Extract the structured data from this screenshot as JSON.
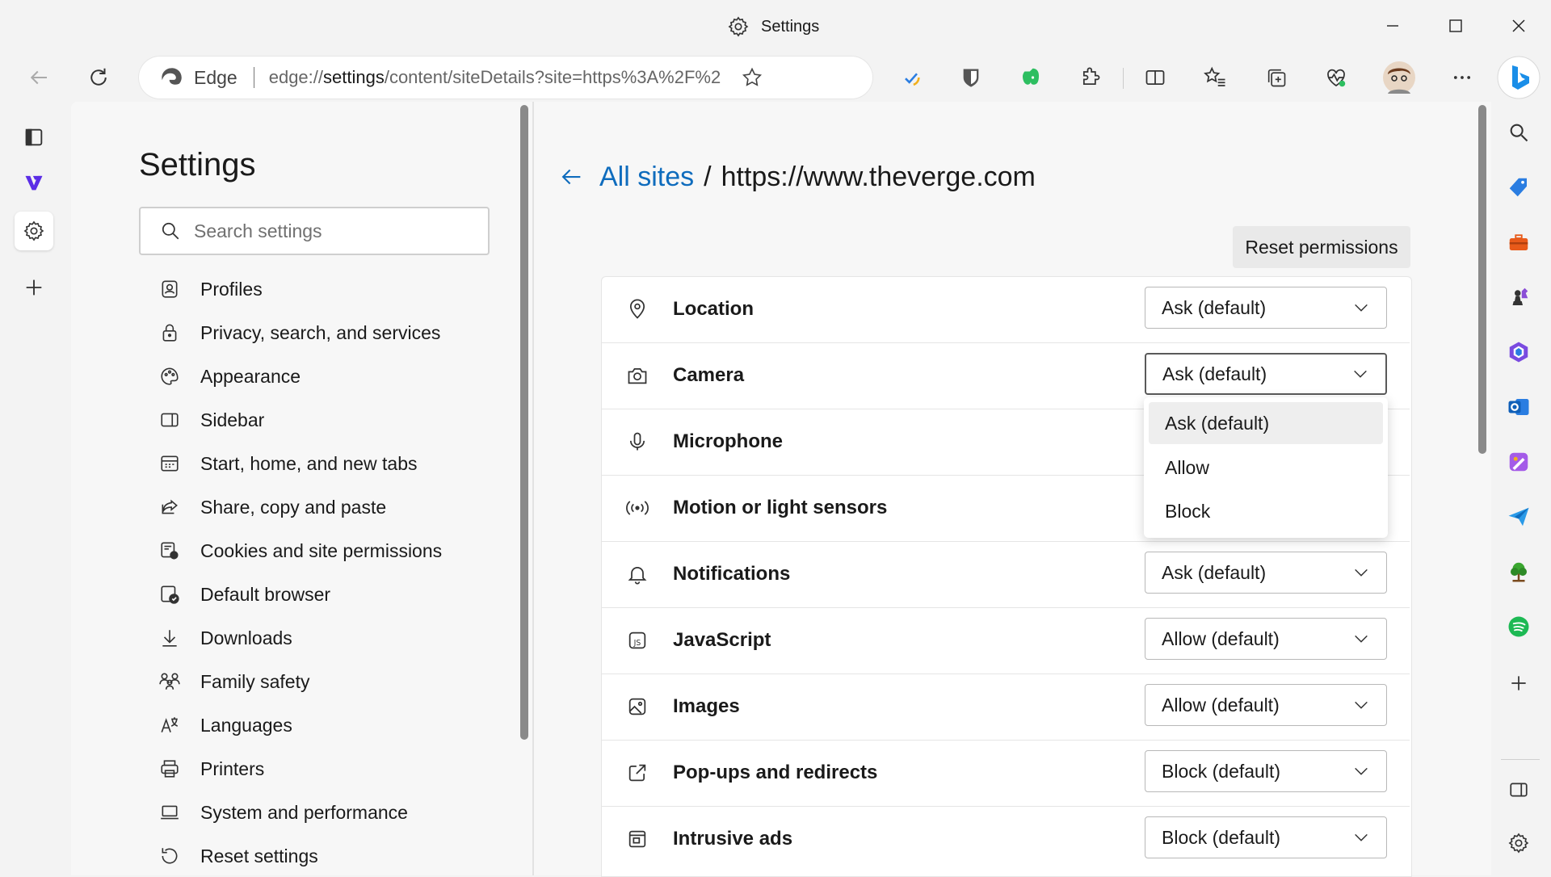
{
  "window": {
    "title": "Settings",
    "controls": [
      "minimize",
      "maximize",
      "close"
    ]
  },
  "addressbar": {
    "brand_label": "Edge",
    "url_prefix": "edge://",
    "url_bold": "settings",
    "url_rest": "/content/siteDetails?site=https%3A%2F%2Fww..."
  },
  "settings": {
    "title": "Settings",
    "search_placeholder": "Search settings",
    "nav": [
      {
        "label": "Profiles",
        "icon": "profile-icon"
      },
      {
        "label": "Privacy, search, and services",
        "icon": "lock-icon"
      },
      {
        "label": "Appearance",
        "icon": "palette-icon"
      },
      {
        "label": "Sidebar",
        "icon": "sidebar-icon"
      },
      {
        "label": "Start, home, and new tabs",
        "icon": "home-tabs-icon"
      },
      {
        "label": "Share, copy and paste",
        "icon": "share-icon"
      },
      {
        "label": "Cookies and site permissions",
        "icon": "cookies-icon"
      },
      {
        "label": "Default browser",
        "icon": "default-browser-icon"
      },
      {
        "label": "Downloads",
        "icon": "download-icon"
      },
      {
        "label": "Family safety",
        "icon": "family-icon"
      },
      {
        "label": "Languages",
        "icon": "languages-icon"
      },
      {
        "label": "Printers",
        "icon": "printer-icon"
      },
      {
        "label": "System and performance",
        "icon": "laptop-icon"
      },
      {
        "label": "Reset settings",
        "icon": "reset-icon"
      }
    ]
  },
  "content": {
    "breadcrumb_link": "All sites",
    "breadcrumb_sep": "/",
    "site": "https://www.theverge.com",
    "reset_button": "Reset permissions",
    "permissions": [
      {
        "label": "Location",
        "value": "Ask (default)",
        "icon": "location-icon"
      },
      {
        "label": "Camera",
        "value": "Ask (default)",
        "icon": "camera-icon"
      },
      {
        "label": "Microphone",
        "value": "",
        "icon": "microphone-icon"
      },
      {
        "label": "Motion or light sensors",
        "value": "",
        "icon": "sensors-icon"
      },
      {
        "label": "Notifications",
        "value": "Ask (default)",
        "icon": "bell-icon"
      },
      {
        "label": "JavaScript",
        "value": "Allow (default)",
        "icon": "javascript-icon"
      },
      {
        "label": "Images",
        "value": "Allow (default)",
        "icon": "image-icon"
      },
      {
        "label": "Pop-ups and redirects",
        "value": "Block (default)",
        "icon": "popup-icon"
      },
      {
        "label": "Intrusive ads",
        "value": "Block (default)",
        "icon": "ads-icon"
      }
    ],
    "dropdown": {
      "options": [
        "Ask (default)",
        "Allow",
        "Block"
      ],
      "highlighted": "Ask (default)"
    }
  },
  "colors": {
    "accent": "#0f6cbd",
    "background": "#f3f3f3",
    "panel": "#f7f7f7"
  }
}
